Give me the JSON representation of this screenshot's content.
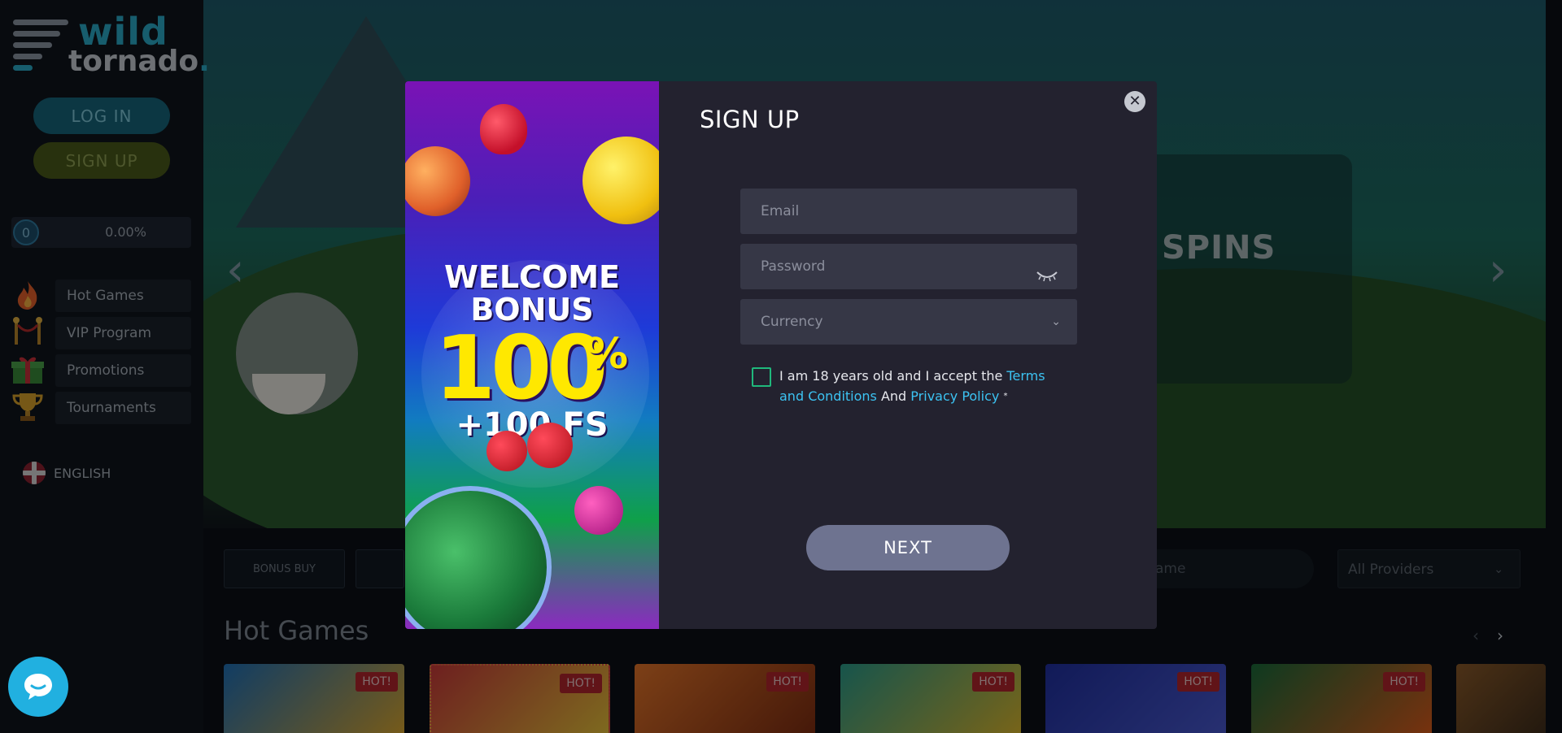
{
  "sidebar": {
    "logo_top": "wild",
    "logo_bottom": "tornado",
    "logo_dot": ".",
    "login_label": "LOG IN",
    "signup_label": "SIGN UP",
    "level": "0",
    "progress_text": "0.00%",
    "progress": 0,
    "menu": [
      {
        "label": "Hot Games",
        "icon": "flame-icon"
      },
      {
        "label": "VIP Program",
        "icon": "vip-rope-icon"
      },
      {
        "label": "Promotions",
        "icon": "gift-icon"
      },
      {
        "label": "Tournaments",
        "icon": "trophy-icon"
      }
    ],
    "language": "ENGLISH"
  },
  "hero": {
    "spins_text": "SPINS"
  },
  "filters": {
    "bonus_buy_label": "BONUS BUY",
    "search_placeholder_fragment": "ame",
    "providers_label": "All Providers"
  },
  "section": {
    "title": "Hot Games",
    "badge": "HOT!"
  },
  "modal": {
    "promo": {
      "line1": "WELCOME",
      "line2": "BONUS",
      "amount": "100",
      "percent": "%",
      "freespins": "+100 FS"
    },
    "title": "SIGN UP",
    "email_placeholder": "Email",
    "password_placeholder": "Password",
    "currency_placeholder": "Currency",
    "terms": {
      "prefix": "I am 18 years old and I accept the ",
      "terms_link": "Terms and Conditions",
      "and": " And ",
      "privacy_link": "Privacy Policy",
      "required": "*"
    },
    "next_label": "NEXT",
    "close_symbol": "✕"
  },
  "colors": {
    "accent_link": "#3cc3f2",
    "checkbox_border": "#1fb97c",
    "hot_badge": "#b1262c",
    "chat_button": "#21b0e0"
  }
}
